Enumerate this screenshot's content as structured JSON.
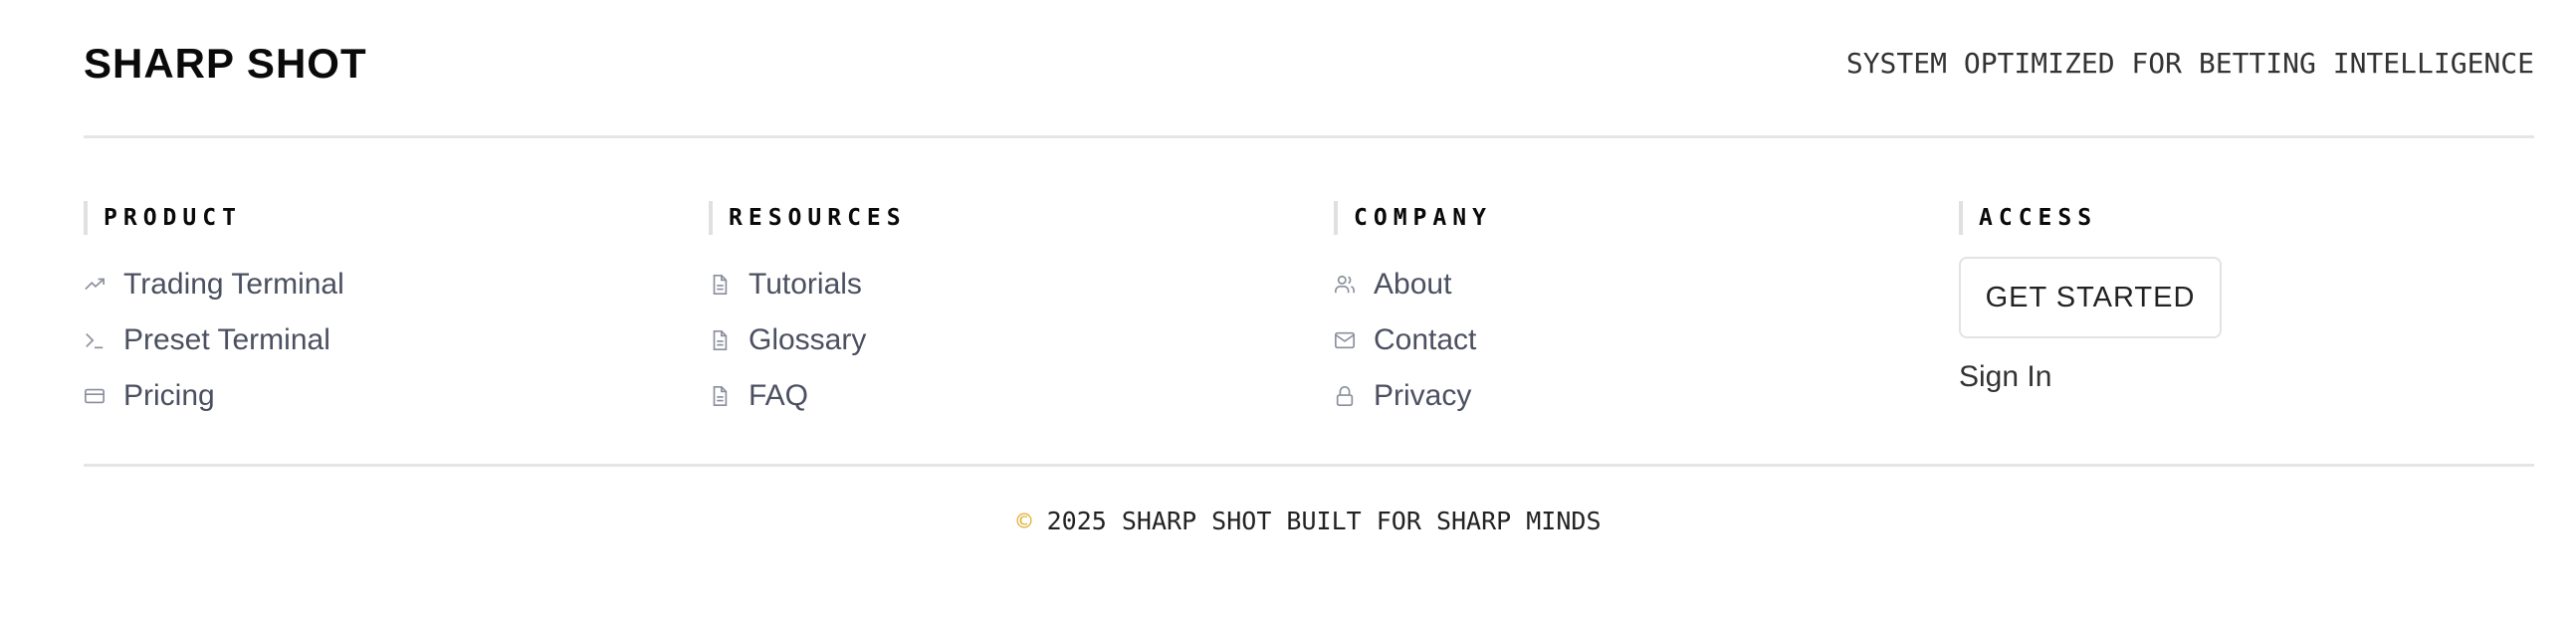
{
  "header": {
    "brand": "SHARP SHOT",
    "tagline": "SYSTEM OPTIMIZED FOR BETTING INTELLIGENCE"
  },
  "columns": {
    "product": {
      "title": "PRODUCT",
      "items": [
        {
          "label": "Trading Terminal",
          "icon": "trending-up-icon"
        },
        {
          "label": "Preset Terminal",
          "icon": "terminal-icon"
        },
        {
          "label": "Pricing",
          "icon": "credit-card-icon"
        }
      ]
    },
    "resources": {
      "title": "RESOURCES",
      "items": [
        {
          "label": "Tutorials",
          "icon": "document-icon"
        },
        {
          "label": "Glossary",
          "icon": "document-icon"
        },
        {
          "label": "FAQ",
          "icon": "document-icon"
        }
      ]
    },
    "company": {
      "title": "COMPANY",
      "items": [
        {
          "label": "About",
          "icon": "users-icon"
        },
        {
          "label": "Contact",
          "icon": "mail-icon"
        },
        {
          "label": "Privacy",
          "icon": "lock-icon"
        }
      ]
    },
    "access": {
      "title": "ACCESS",
      "get_started": "GET STARTED",
      "sign_in": "Sign In"
    }
  },
  "footer": {
    "copyright_symbol": "©",
    "copyright_text": "2025 SHARP SHOT BUILT FOR SHARP MINDS",
    "accent": "#e0b030"
  }
}
